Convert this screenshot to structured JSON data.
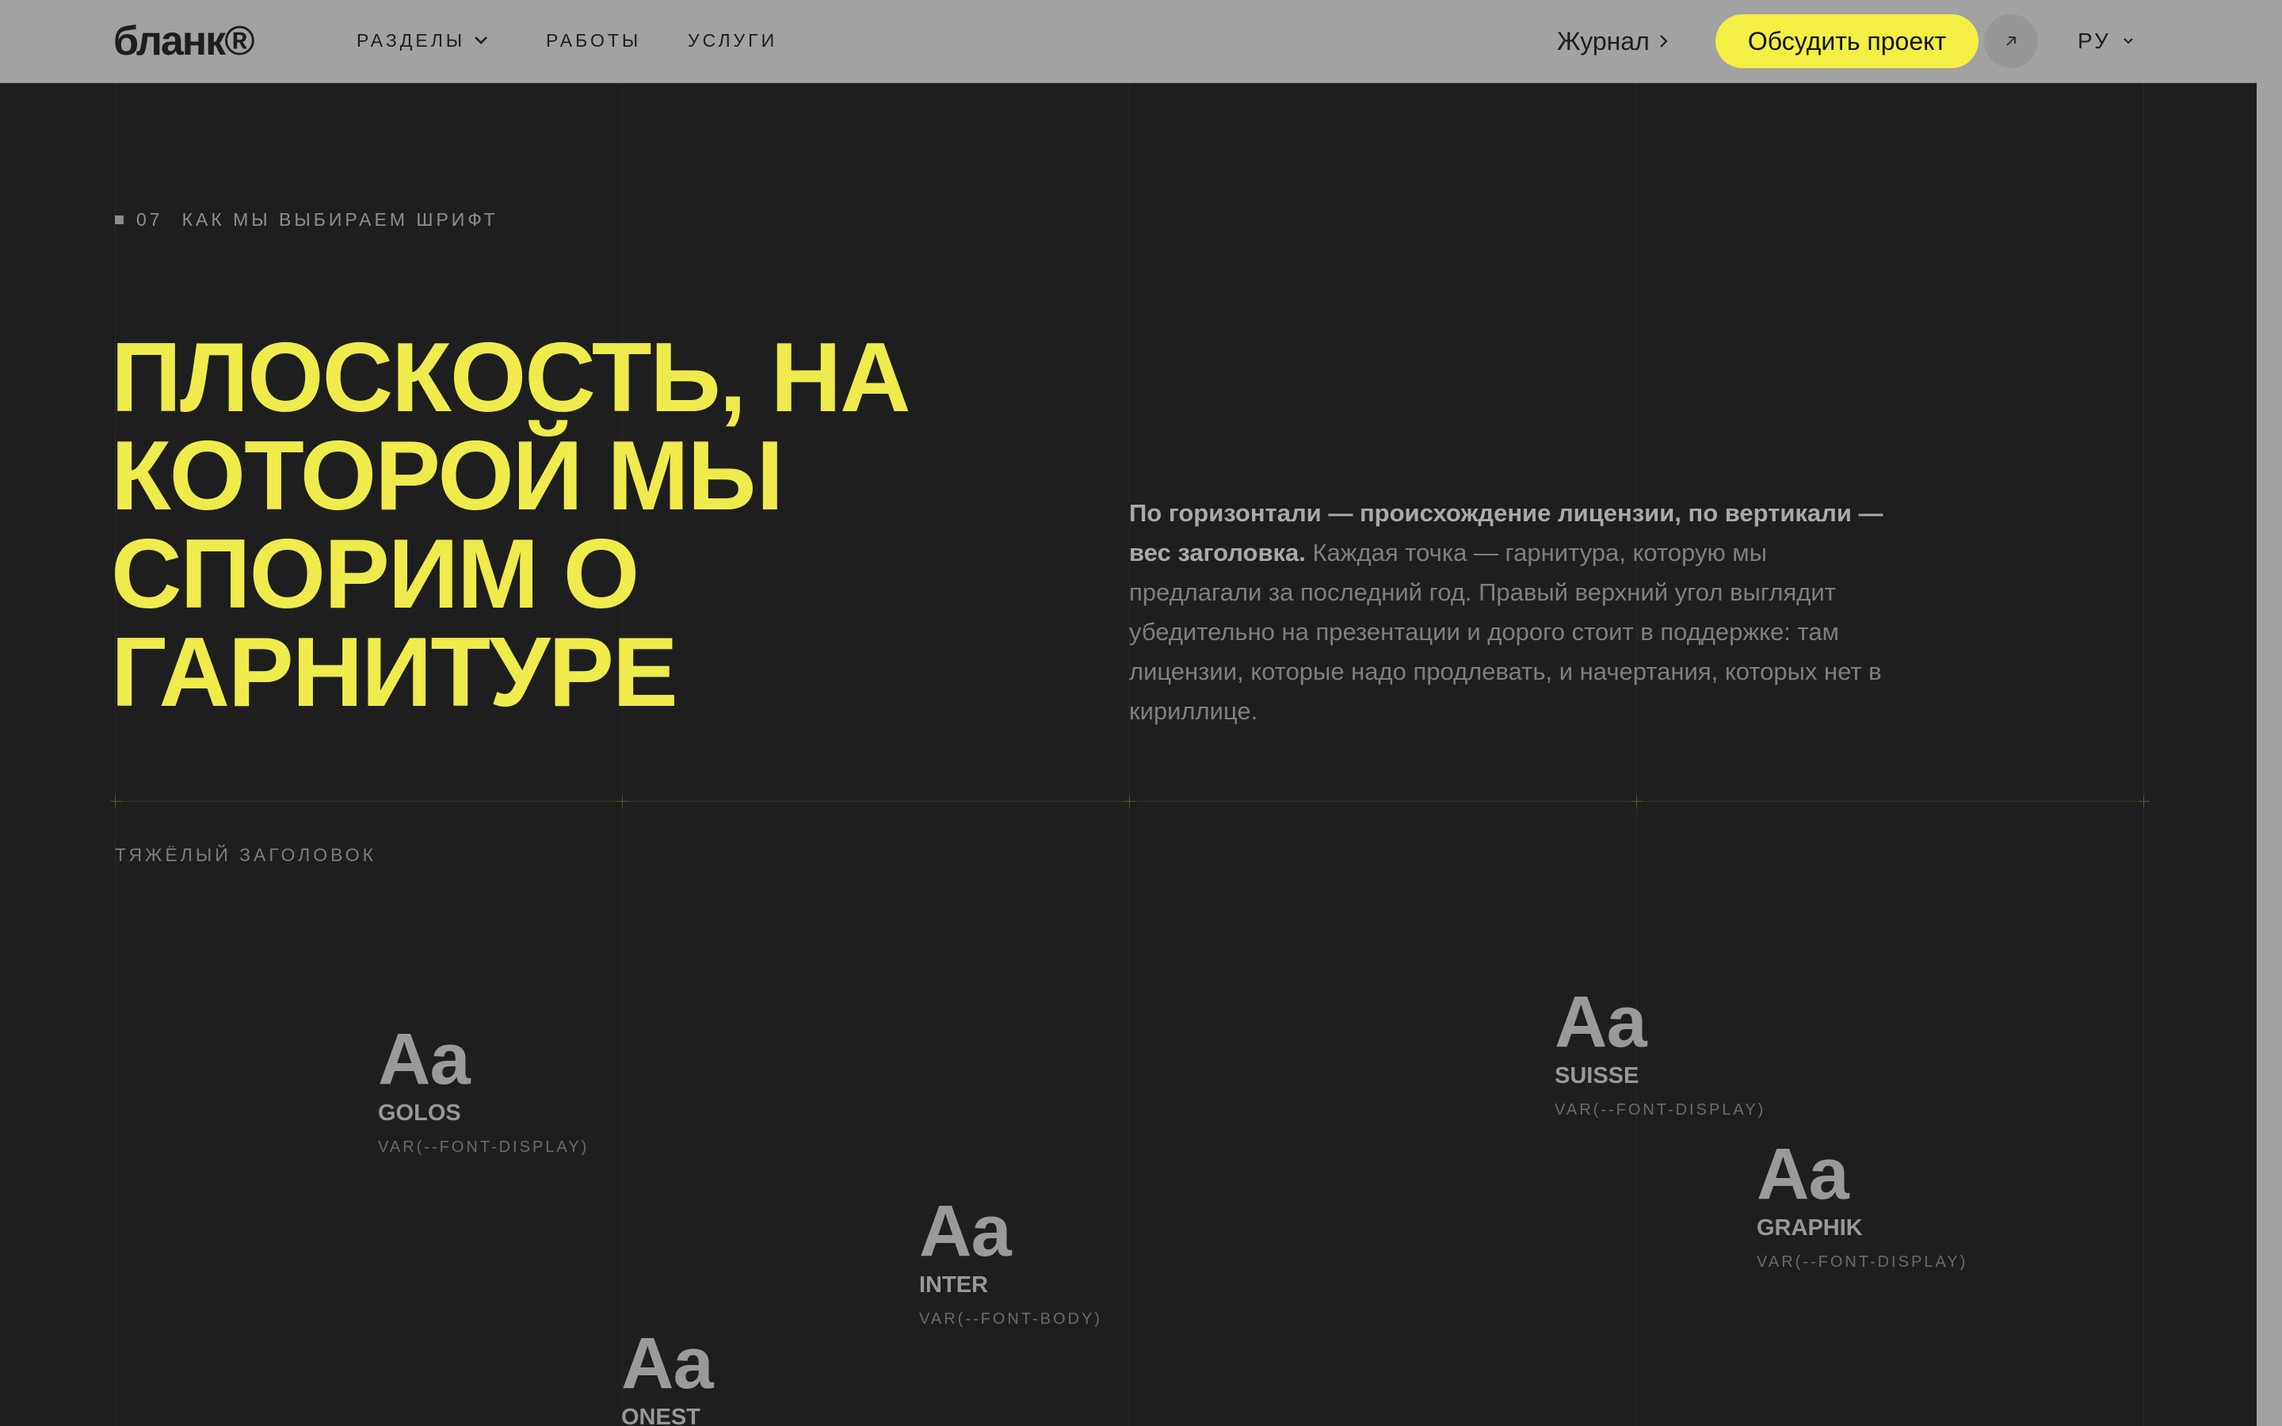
{
  "header": {
    "logo": "бланк®",
    "nav": {
      "sections": "РАЗДЕЛЫ",
      "works": "РАБОТЫ",
      "services": "УСЛУГИ"
    },
    "journal": "Журнал",
    "cta": "Обсудить проект",
    "lang": "РУ"
  },
  "section": {
    "number": "07",
    "eyebrow": "КАК МЫ ВЫБИРАЕМ ШРИФТ",
    "headline": "ПЛОСКОСТЬ, НА\nКОТОРОЙ МЫ\nСПОРИМ О\nГАРНИТУРЕ",
    "para_bold": "По горизонтали — происхождение лицензии, по вертикали — вес заголовка.",
    "para_rest": " Каждая точка — гарнитура, которую мы предлагали за последний год. Правый верхний угол выглядит убедительно на презентации и дорого стоит в поддержке: там лицензии, которые надо продлевать, и начертания, которых нет в кириллице.",
    "axis_label": "ТЯЖЁЛЫЙ ЗАГОЛОВОК"
  },
  "fonts": [
    {
      "sample": "Aa",
      "name": "GOLOS",
      "var": "VAR(--FONT-DISPLAY)"
    },
    {
      "sample": "Aa",
      "name": "INTER",
      "var": "VAR(--FONT-BODY)"
    },
    {
      "sample": "Aa",
      "name": "ONEST",
      "var": ""
    },
    {
      "sample": "Aa",
      "name": "SUISSE",
      "var": "VAR(--FONT-DISPLAY)"
    },
    {
      "sample": "Aa",
      "name": "GRAPHIK",
      "var": "VAR(--FONT-DISPLAY)"
    }
  ],
  "colors": {
    "accent": "#efeb4c",
    "background": "#1e1e1e",
    "topbar": "#a2a2a2"
  },
  "icons": [
    "chevron-down-icon",
    "chevron-right-icon",
    "arrow-up-right-icon"
  ]
}
